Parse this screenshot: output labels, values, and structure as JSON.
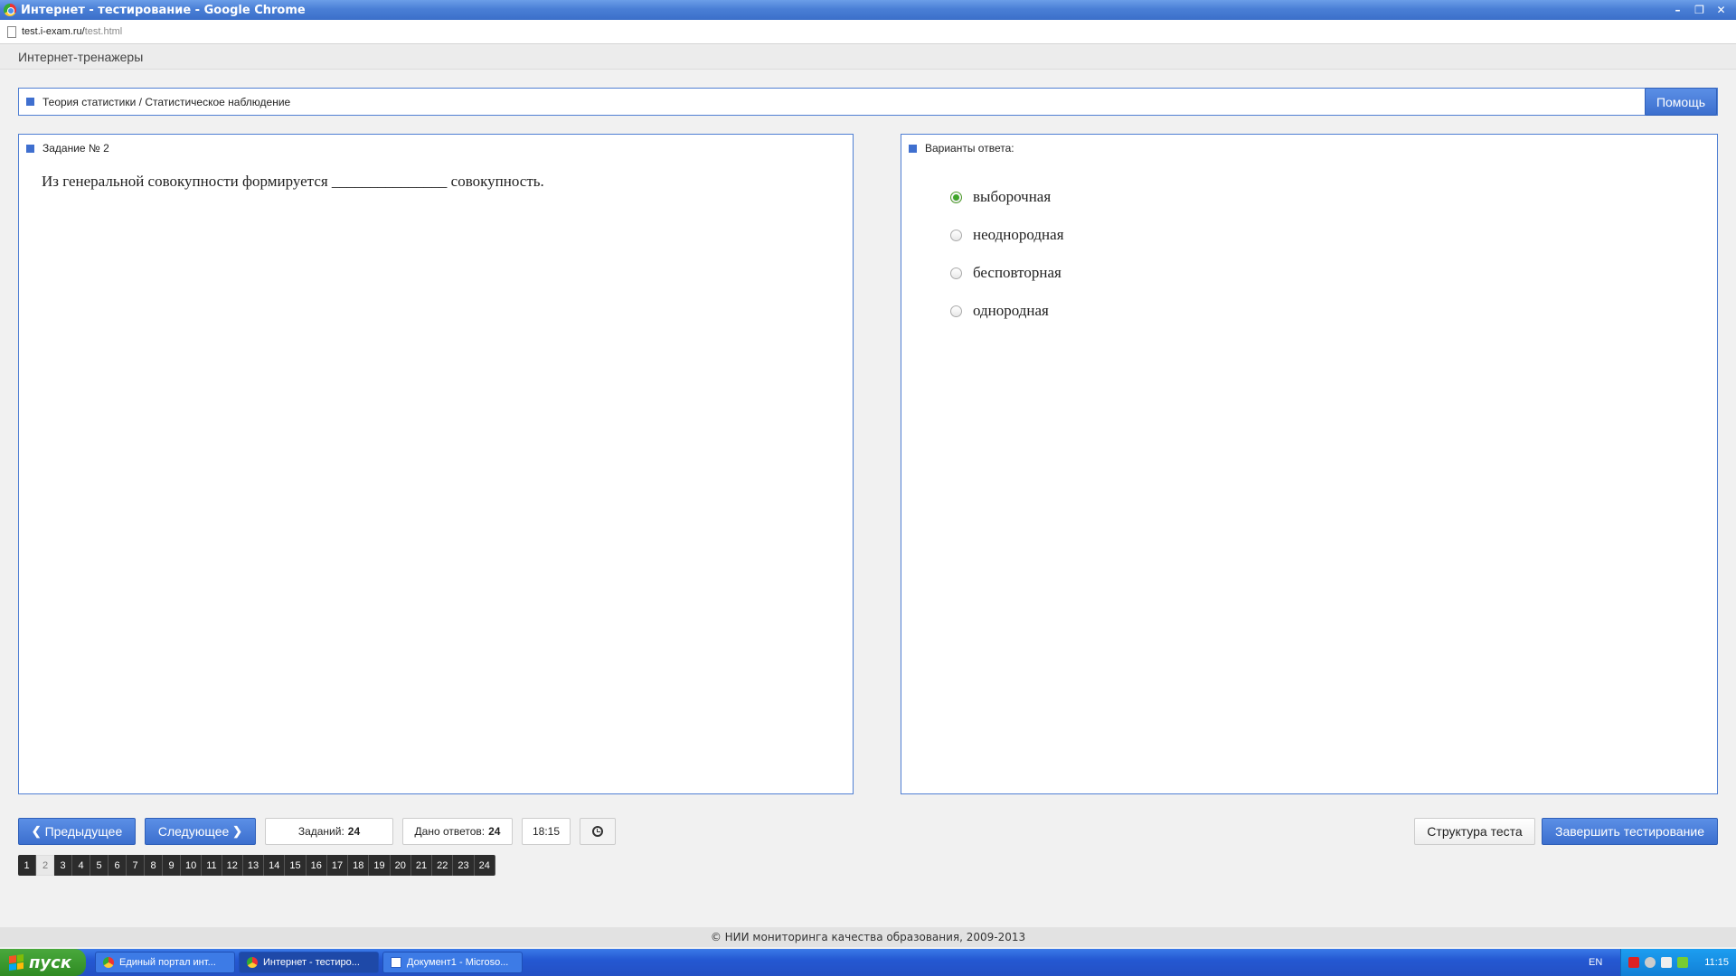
{
  "window": {
    "title": "Интернет - тестирование - Google Chrome",
    "controls": [
      "–",
      "❐",
      "✕"
    ]
  },
  "address": {
    "host": "test.i-exam.ru/",
    "path": "test.html"
  },
  "app": {
    "header_title": "Интернет-тренажеры"
  },
  "breadcrumb": {
    "text": "Теория статистики / Статистическое наблюдение",
    "help_label": "Помощь"
  },
  "task_panel": {
    "heading": "Задание № 2",
    "question": "Из генеральной совокупности формируется _______________ совокупность."
  },
  "answers_panel": {
    "heading": "Варианты ответа:",
    "options": [
      {
        "label": "выборочная",
        "selected": true
      },
      {
        "label": "неоднородная",
        "selected": false
      },
      {
        "label": "бесповторная",
        "selected": false
      },
      {
        "label": "однородная",
        "selected": false
      }
    ]
  },
  "controls": {
    "prev_label": "Предыдущее",
    "next_label": "Следующее",
    "tasks_label": "Заданий:",
    "tasks_value": "24",
    "answers_label": "Дано ответов:",
    "answers_value": "24",
    "timer": "18:15",
    "structure_label": "Структура теста",
    "finish_label": "Завершить тестирование"
  },
  "pagination": {
    "pages": [
      "1",
      "2",
      "3",
      "4",
      "5",
      "6",
      "7",
      "8",
      "9",
      "10",
      "11",
      "12",
      "13",
      "14",
      "15",
      "16",
      "17",
      "18",
      "19",
      "20",
      "21",
      "22",
      "23",
      "24"
    ],
    "current": "2"
  },
  "footer": {
    "copyright": "© НИИ мониторинга качества образования, 2009-2013"
  },
  "taskbar": {
    "start_label": "пуск",
    "items": [
      {
        "label": "Единый портал инт...",
        "icon": "chrome-icon",
        "active": false
      },
      {
        "label": "Интернет - тестиро...",
        "icon": "chrome-icon",
        "active": true
      },
      {
        "label": "Документ1 - Microso...",
        "icon": "word-doc-icon",
        "active": false
      }
    ],
    "lang": "EN",
    "clock": "11:15"
  },
  "colors": {
    "accent": "#3f6fcf",
    "panel_border": "#4f7fd3",
    "selected_radio": "#3fa52a"
  }
}
